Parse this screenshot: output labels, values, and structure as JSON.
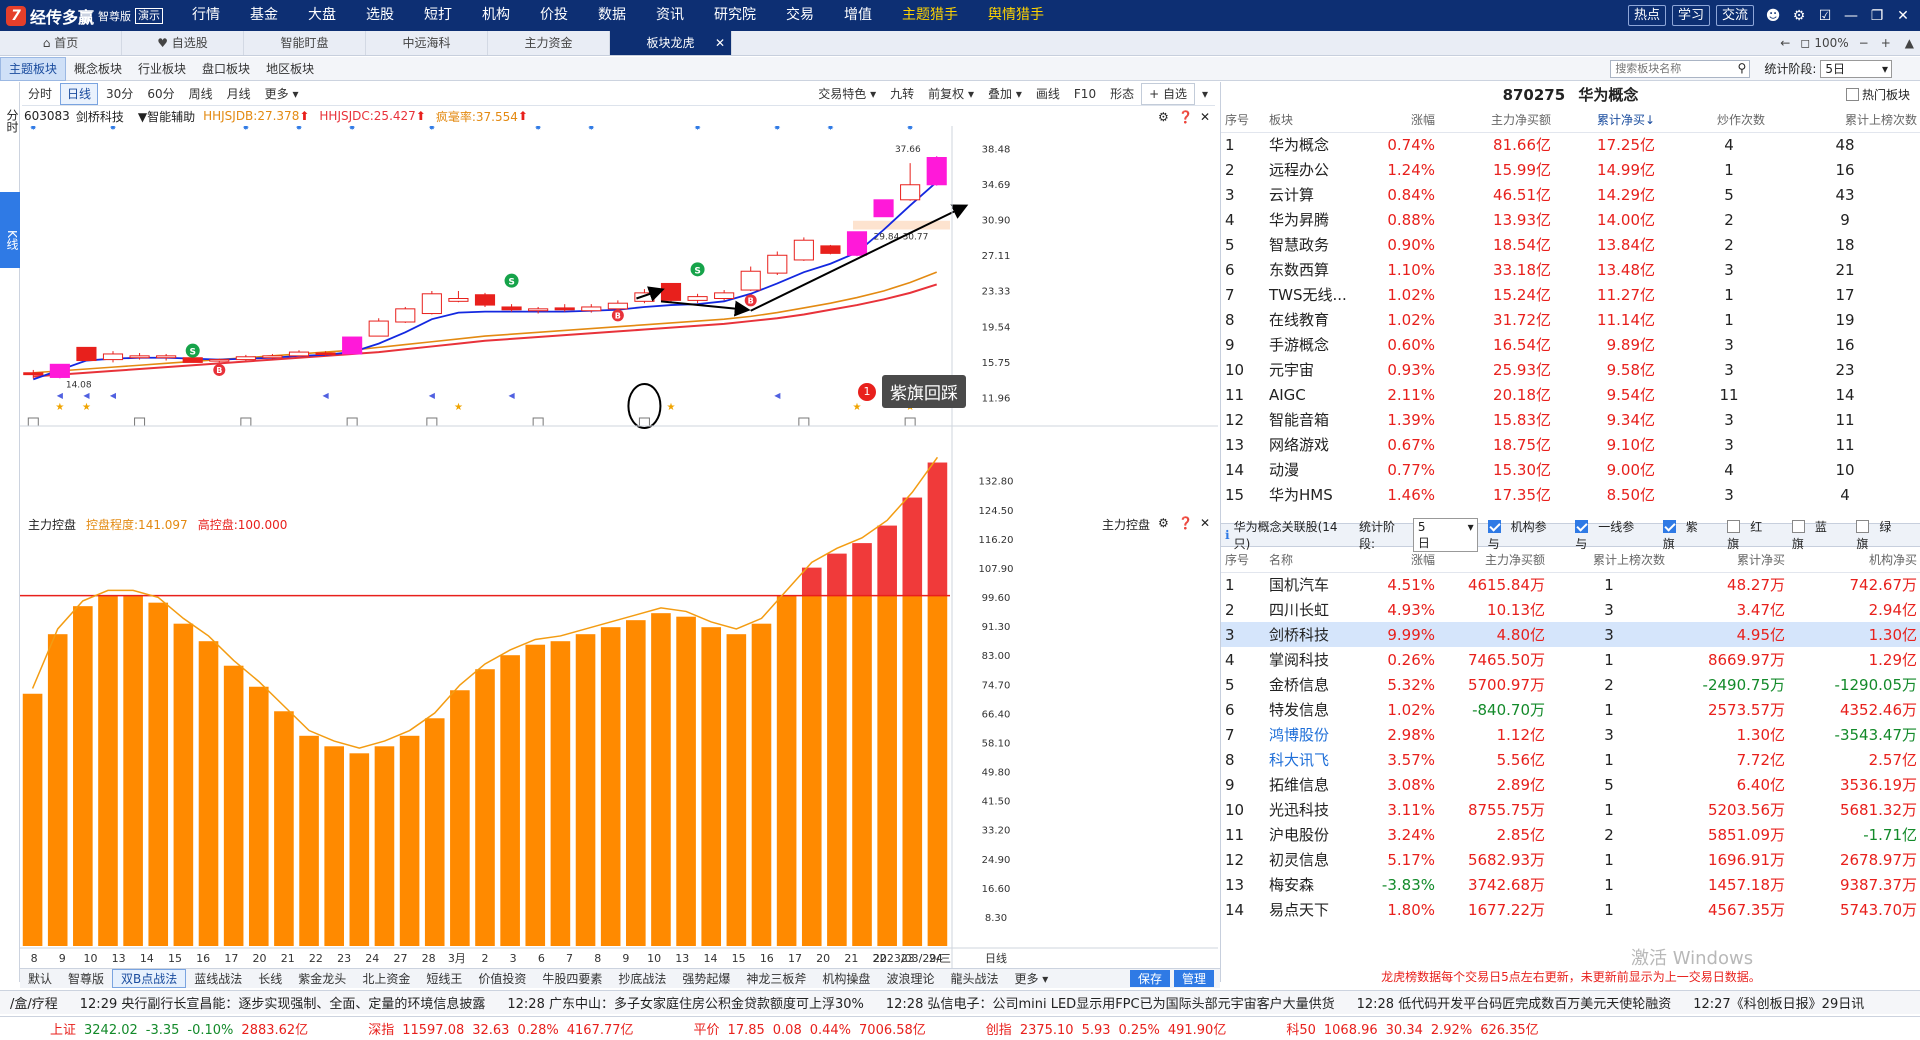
{
  "app": {
    "logo_mark": "7",
    "name": "经传多赢",
    "edition": "智尊版",
    "demo": "演示",
    "menu": [
      "行情",
      "基金",
      "大盘",
      "选股",
      "短打",
      "机构",
      "价投",
      "数据",
      "资讯",
      "研究院",
      "交易",
      "增值",
      "主题猎手",
      "舆情猎手"
    ],
    "top_buttons": [
      "热点",
      "学习",
      "交流"
    ]
  },
  "tabs": [
    {
      "label": "首页"
    },
    {
      "label": "自选股"
    },
    {
      "label": "智能盯盘"
    },
    {
      "label": "中远海科"
    },
    {
      "label": "主力资金"
    },
    {
      "label": "板块龙虎"
    }
  ],
  "subtabs": [
    "主题板块",
    "概念板块",
    "行业板块",
    "盘口板块",
    "地区板块"
  ],
  "zoom": "100%",
  "search": {
    "placeholder": "搜索板块名称"
  },
  "stat_period": {
    "label": "统计阶段:",
    "value": "5日"
  },
  "leftbar": {
    "tab1": "分时",
    "tab2": "K线"
  },
  "periods": [
    "分时",
    "日线",
    "30分",
    "60分",
    "周线",
    "月线",
    "更多"
  ],
  "chart_tools": [
    "交易特色",
    "九转",
    "前复权",
    "叠加",
    "画线",
    "F10",
    "形态",
    "+ 自选"
  ],
  "stock": {
    "code": "603083",
    "name": "剑桥科技",
    "assist": "智能辅助",
    "ind1": "HHJSJDB:27.378",
    "ind2": "HHJSJDC:25.427",
    "ind3": "疯毫率:37.554"
  },
  "lower": {
    "title": "主力控盘",
    "ind1": "控盘程度:141.097",
    "ind2": "高控盘:100.000",
    "right_label": "主力控盘"
  },
  "chart_data": [
    {
      "type": "candlestick",
      "title": "603083 剑桥科技",
      "ylim": [
        10.0,
        40.0
      ],
      "yticks": [
        "38.48",
        "34.69",
        "30.90",
        "27.11",
        "23.33",
        "19.54",
        "15.75",
        "11.96"
      ],
      "xticks": [
        "8",
        "9",
        "10",
        "13",
        "14",
        "15",
        "16",
        "17",
        "20",
        "21",
        "22",
        "23",
        "24",
        "27",
        "28",
        "3月",
        "2",
        "3",
        "6",
        "7",
        "8",
        "9",
        "10",
        "13",
        "14",
        "15",
        "16",
        "17",
        "20",
        "21",
        "22",
        "23",
        "24",
        "2023/03/29/三",
        "日线"
      ],
      "candles": [
        {
          "o": 14.6,
          "h": 14.9,
          "l": 14.0,
          "c": 14.4,
          "color": "red"
        },
        {
          "o": 14.1,
          "h": 15.5,
          "l": 14.0,
          "c": 15.5,
          "color": "magenta"
        },
        {
          "o": 15.9,
          "h": 17.3,
          "l": 15.9,
          "c": 17.3,
          "color": "red"
        },
        {
          "o": 16.0,
          "h": 16.9,
          "l": 15.7,
          "c": 16.6,
          "color": "hollow"
        },
        {
          "o": 16.2,
          "h": 16.7,
          "l": 16.0,
          "c": 16.4,
          "color": "hollow"
        },
        {
          "o": 16.2,
          "h": 16.6,
          "l": 15.9,
          "c": 16.4,
          "color": "hollow"
        },
        {
          "o": 15.7,
          "h": 16.4,
          "l": 15.7,
          "c": 16.2,
          "color": "red"
        },
        {
          "o": 15.9,
          "h": 16.1,
          "l": 15.7,
          "c": 16.0,
          "color": "hollow"
        },
        {
          "o": 16.0,
          "h": 16.5,
          "l": 15.9,
          "c": 16.3,
          "color": "hollow"
        },
        {
          "o": 16.2,
          "h": 16.6,
          "l": 16.0,
          "c": 16.4,
          "color": "hollow"
        },
        {
          "o": 16.4,
          "h": 17.0,
          "l": 16.3,
          "c": 16.8,
          "color": "hollow"
        },
        {
          "o": 16.7,
          "h": 16.9,
          "l": 16.4,
          "c": 16.6,
          "color": "red"
        },
        {
          "o": 16.6,
          "h": 18.4,
          "l": 16.6,
          "c": 18.4,
          "color": "magenta"
        },
        {
          "o": 18.5,
          "h": 20.4,
          "l": 18.5,
          "c": 20.1,
          "color": "hollow"
        },
        {
          "o": 20.0,
          "h": 21.6,
          "l": 19.9,
          "c": 21.4,
          "color": "hollow"
        },
        {
          "o": 20.9,
          "h": 23.3,
          "l": 20.8,
          "c": 23.0,
          "color": "hollow"
        },
        {
          "o": 22.2,
          "h": 23.3,
          "l": 22.1,
          "c": 22.5,
          "color": "hollow"
        },
        {
          "o": 22.9,
          "h": 23.1,
          "l": 21.6,
          "c": 21.8,
          "color": "red"
        },
        {
          "o": 21.6,
          "h": 21.9,
          "l": 21.1,
          "c": 21.3,
          "color": "red"
        },
        {
          "o": 21.2,
          "h": 21.6,
          "l": 20.9,
          "c": 21.4,
          "color": "hollow"
        },
        {
          "o": 21.5,
          "h": 21.9,
          "l": 21.1,
          "c": 21.3,
          "color": "red"
        },
        {
          "o": 21.2,
          "h": 21.9,
          "l": 21.0,
          "c": 21.6,
          "color": "hollow"
        },
        {
          "o": 21.4,
          "h": 22.3,
          "l": 21.3,
          "c": 22.0,
          "color": "hollow"
        },
        {
          "o": 22.2,
          "h": 23.5,
          "l": 22.0,
          "c": 23.1,
          "color": "hollow"
        },
        {
          "o": 24.1,
          "h": 24.1,
          "l": 22.1,
          "c": 22.3,
          "color": "red"
        },
        {
          "o": 22.3,
          "h": 23.0,
          "l": 22.0,
          "c": 22.7,
          "color": "hollow"
        },
        {
          "o": 22.5,
          "h": 23.4,
          "l": 22.3,
          "c": 23.1,
          "color": "hollow"
        },
        {
          "o": 23.4,
          "h": 25.9,
          "l": 23.3,
          "c": 25.4,
          "color": "hollow"
        },
        {
          "o": 25.2,
          "h": 27.5,
          "l": 25.0,
          "c": 27.1,
          "color": "hollow"
        },
        {
          "o": 26.6,
          "h": 29.0,
          "l": 26.5,
          "c": 28.7,
          "color": "hollow"
        },
        {
          "o": 28.1,
          "h": 28.2,
          "l": 27.2,
          "c": 27.3,
          "color": "red"
        },
        {
          "o": 27.1,
          "h": 29.6,
          "l": 27.0,
          "c": 29.6,
          "color": "magenta"
        },
        {
          "o": 31.2,
          "h": 33.0,
          "l": 31.2,
          "c": 33.0,
          "color": "magenta"
        },
        {
          "o": 33.0,
          "h": 36.9,
          "l": 32.9,
          "c": 34.6,
          "color": "hollow"
        },
        {
          "o": 34.6,
          "h": 37.66,
          "l": 34.5,
          "c": 37.5,
          "color": "magenta"
        }
      ],
      "lines": {
        "blue": [
          13.9,
          14.9,
          15.9,
          16.1,
          16.2,
          16.2,
          16.1,
          16.0,
          16.1,
          16.2,
          16.4,
          16.5,
          16.8,
          17.7,
          18.9,
          20.3,
          21.0,
          21.1,
          21.1,
          21.1,
          21.1,
          21.2,
          21.3,
          21.6,
          21.8,
          21.9,
          22.2,
          23.0,
          24.1,
          25.3,
          26.2,
          27.4,
          29.8,
          32.4,
          34.9
        ],
        "orange": [
          14.6,
          14.8,
          15.0,
          15.2,
          15.4,
          15.6,
          15.8,
          16.0,
          16.2,
          16.4,
          16.6,
          16.8,
          17.0,
          17.3,
          17.6,
          17.9,
          18.2,
          18.5,
          18.7,
          18.9,
          19.1,
          19.3,
          19.5,
          19.7,
          19.9,
          20.1,
          20.3,
          20.6,
          21.0,
          21.5,
          22.0,
          22.6,
          23.3,
          24.2,
          25.3
        ],
        "red": [
          14.2,
          14.4,
          14.6,
          14.8,
          15.0,
          15.2,
          15.4,
          15.6,
          15.8,
          16.0,
          16.2,
          16.4,
          16.6,
          16.8,
          17.1,
          17.4,
          17.7,
          18.0,
          18.2,
          18.4,
          18.6,
          18.8,
          19.0,
          19.2,
          19.4,
          19.6,
          19.8,
          20.1,
          20.4,
          20.8,
          21.3,
          21.8,
          22.4,
          23.1,
          24.0
        ]
      },
      "min_label": "14.08",
      "max_label": "37.66",
      "zone_label": "29.84-30.77",
      "annotation": {
        "number": "1",
        "text": "紫旗回踩"
      }
    },
    {
      "type": "bar",
      "title": "主力控盘",
      "ylim": [
        0,
        145
      ],
      "yticks": [
        "132.80",
        "124.50",
        "116.20",
        "107.90",
        "99.60",
        "91.30",
        "83.00",
        "74.70",
        "66.40",
        "58.10",
        "49.80",
        "41.50",
        "33.20",
        "24.90",
        "16.60",
        "8.30"
      ],
      "threshold": 100.0,
      "values": [
        72,
        89,
        97,
        100,
        100,
        98,
        92,
        87,
        80,
        74,
        67,
        60,
        57,
        55,
        57,
        60,
        65,
        73,
        79,
        83,
        86,
        87,
        89,
        91,
        93,
        95,
        94,
        91,
        89,
        92,
        100,
        108,
        112,
        115,
        120,
        128,
        138
      ]
    }
  ],
  "right_top": {
    "code": "870275",
    "name": "华为概念",
    "hot_label": "热门板块",
    "headers": [
      "序号",
      "板块",
      "涨幅",
      "主力净买额",
      "累计净买↓",
      "炒作次数",
      "累计上榜次数"
    ],
    "rows": [
      [
        "1",
        "华为概念",
        "0.74%",
        "81.66亿",
        "17.25亿",
        "4",
        "48"
      ],
      [
        "2",
        "远程办公",
        "1.24%",
        "15.99亿",
        "14.99亿",
        "1",
        "16"
      ],
      [
        "3",
        "云计算",
        "0.84%",
        "46.51亿",
        "14.29亿",
        "5",
        "43"
      ],
      [
        "4",
        "华为昇腾",
        "0.88%",
        "13.93亿",
        "14.00亿",
        "2",
        "9"
      ],
      [
        "5",
        "智慧政务",
        "0.90%",
        "18.54亿",
        "13.84亿",
        "2",
        "18"
      ],
      [
        "6",
        "东数西算",
        "1.10%",
        "33.18亿",
        "13.48亿",
        "3",
        "21"
      ],
      [
        "7",
        "TWS无线...",
        "1.02%",
        "15.24亿",
        "11.27亿",
        "1",
        "17"
      ],
      [
        "8",
        "在线教育",
        "1.02%",
        "31.72亿",
        "11.14亿",
        "1",
        "19"
      ],
      [
        "9",
        "手游概念",
        "0.60%",
        "16.54亿",
        "9.89亿",
        "3",
        "16"
      ],
      [
        "10",
        "元宇宙",
        "0.93%",
        "25.93亿",
        "9.58亿",
        "3",
        "23"
      ],
      [
        "11",
        "AIGC",
        "2.11%",
        "20.18亿",
        "9.54亿",
        "11",
        "14"
      ],
      [
        "12",
        "智能音箱",
        "1.39%",
        "15.83亿",
        "9.34亿",
        "3",
        "11"
      ],
      [
        "13",
        "网络游戏",
        "0.67%",
        "18.75亿",
        "9.10亿",
        "3",
        "11"
      ],
      [
        "14",
        "动漫",
        "0.77%",
        "15.30亿",
        "9.00亿",
        "4",
        "10"
      ],
      [
        "15",
        "华为HMS",
        "1.46%",
        "17.35亿",
        "8.50亿",
        "3",
        "4"
      ]
    ]
  },
  "right_bottom": {
    "title": "华为概念关联股(14只)",
    "stat_label": "统计阶段:",
    "stat_value": "5日",
    "filters": [
      {
        "label": "机构参与",
        "on": true
      },
      {
        "label": "一线参与",
        "on": true
      },
      {
        "label": "紫旗",
        "on": true
      },
      {
        "label": "红旗",
        "on": false
      },
      {
        "label": "蓝旗",
        "on": false
      },
      {
        "label": "绿旗",
        "on": false
      }
    ],
    "headers": [
      "序号",
      "名称",
      "涨幅",
      "主力净买额",
      "累计上榜次数",
      "累计净买",
      "机构净买"
    ],
    "rows": [
      [
        "1",
        "国机汽车",
        "4.51%",
        "4615.84万",
        "1",
        "48.27万",
        "742.67万"
      ],
      [
        "2",
        "四川长虹",
        "4.93%",
        "10.13亿",
        "3",
        "3.47亿",
        "2.94亿"
      ],
      [
        "3",
        "剑桥科技",
        "9.99%",
        "4.80亿",
        "3",
        "4.95亿",
        "1.30亿"
      ],
      [
        "4",
        "掌阅科技",
        "0.26%",
        "7465.50万",
        "1",
        "8669.97万",
        "1.29亿"
      ],
      [
        "5",
        "金桥信息",
        "5.32%",
        "5700.97万",
        "2",
        "-2490.75万",
        "-1290.05万"
      ],
      [
        "6",
        "特发信息",
        "1.02%",
        "-840.70万",
        "1",
        "2573.57万",
        "4352.46万"
      ],
      [
        "7",
        "鸿博股份",
        "2.98%",
        "1.12亿",
        "3",
        "1.30亿",
        "-3543.47万"
      ],
      [
        "8",
        "科大讯飞",
        "3.57%",
        "5.56亿",
        "1",
        "7.72亿",
        "2.57亿"
      ],
      [
        "9",
        "拓维信息",
        "3.08%",
        "2.89亿",
        "5",
        "6.40亿",
        "3536.19万"
      ],
      [
        "10",
        "光迅科技",
        "3.11%",
        "8755.75万",
        "1",
        "5203.56万",
        "5681.32万"
      ],
      [
        "11",
        "沪电股份",
        "3.24%",
        "2.85亿",
        "2",
        "5851.09万",
        "-1.71亿"
      ],
      [
        "12",
        "初灵信息",
        "5.17%",
        "5682.93万",
        "1",
        "1696.91万",
        "2678.97万"
      ],
      [
        "13",
        "梅安森",
        "-3.83%",
        "3742.68万",
        "1",
        "1457.18万",
        "9387.37万"
      ],
      [
        "14",
        "易点天下",
        "1.80%",
        "1677.22万",
        "1",
        "4567.35万",
        "5743.70万"
      ]
    ],
    "notice": "龙虎榜数据每个交易日5点左右更新，未更新前显示为上一交易日数据。",
    "watermark": "激活 Windows"
  },
  "strategies": [
    "默认",
    "智尊版",
    "双B点战法",
    "蓝线战法",
    "长线",
    "紫金龙头",
    "北上资金",
    "短线王",
    "价值投资",
    "牛股四要素",
    "抄底战法",
    "强势起爆",
    "神龙三板斧",
    "机构操盘",
    "波浪理论",
    "龍头战法",
    "更多"
  ],
  "strategy_actions": [
    "保存",
    "管理"
  ],
  "ticker": {
    "prefix": "/盒/疗程",
    "items": [
      "12:29 央行副行长宣昌能：逐步实现强制、全面、定量的环境信息披露",
      "12:28 广东中山：多子女家庭住房公积金贷款额度可上浮30%",
      "12:28 弘信电子：公司mini LED显示用FPC已为国际头部元宇宙客户大量供货",
      "12:28 低代码开发平台码匠完成数百万美元天使轮融资",
      "12:27《科创板日报》29日讯"
    ]
  },
  "indices": [
    {
      "name": "上证",
      "value": "3242.02",
      "chg": "-3.35",
      "pct": "-0.10%",
      "amt": "2883.62亿"
    },
    {
      "name": "深指",
      "value": "11597.08",
      "chg": "32.63",
      "pct": "0.28%",
      "amt": "4167.77亿"
    },
    {
      "name": "平价",
      "value": "17.85",
      "chg": "0.08",
      "pct": "0.44%",
      "amt": "7006.58亿"
    },
    {
      "name": "创指",
      "value": "2375.10",
      "chg": "5.93",
      "pct": "0.25%",
      "amt": "491.90亿"
    },
    {
      "name": "科50",
      "value": "1068.96",
      "chg": "30.34",
      "pct": "2.92%",
      "amt": "626.35亿"
    }
  ],
  "colors": {
    "brand": "#0d2f73",
    "up": "#e8201c",
    "down": "#138a2a",
    "magenta": "#ff19d9",
    "bar": "#ff8a00",
    "barTop": "#f03a3a",
    "line_blue": "#1328e0",
    "line_orange": "#e38a12",
    "line_red": "#e8323a"
  }
}
